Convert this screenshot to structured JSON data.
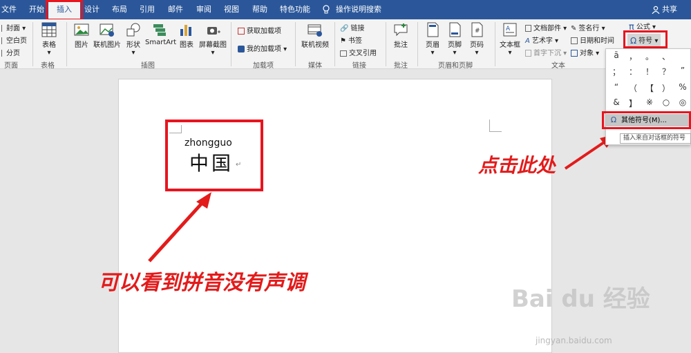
{
  "menubar": {
    "tabs": [
      {
        "label": "文件"
      },
      {
        "label": "开始"
      },
      {
        "label": "插入"
      },
      {
        "label": "设计"
      },
      {
        "label": "布局"
      },
      {
        "label": "引用"
      },
      {
        "label": "邮件"
      },
      {
        "label": "审阅"
      },
      {
        "label": "视图"
      },
      {
        "label": "帮助"
      },
      {
        "label": "特色功能"
      }
    ],
    "search_label": "操作说明搜索",
    "share_label": "共享"
  },
  "ribbon": {
    "pages": {
      "items": [
        "封面",
        "空白页",
        "分页"
      ],
      "group_label": "页面"
    },
    "tables": {
      "table_label": "表格",
      "group_label": "表格"
    },
    "illustrations": {
      "items": [
        "图片",
        "联机图片",
        "形状",
        "SmartArt",
        "图表",
        "屏幕截图"
      ],
      "group_label": "插图"
    },
    "addins": {
      "get_label": "获取加载项",
      "mine_label": "我的加载项",
      "group_label": "加载项"
    },
    "media": {
      "online_video_label": "联机视频",
      "group_label": "媒体"
    },
    "links": {
      "items": [
        "链接",
        "书签",
        "交叉引用"
      ],
      "group_label": "链接"
    },
    "comments": {
      "comment_label": "批注",
      "group_label": "批注"
    },
    "header_footer": {
      "items": [
        "页眉",
        "页脚",
        "页码"
      ],
      "group_label": "页眉和页脚"
    },
    "text": {
      "textbox_label": "文本框",
      "quick_parts_label": "文档部件",
      "wordart_label": "艺术字",
      "dropcap_label": "首字下沉",
      "signature_label": "签名行",
      "datetime_label": "日期和时间",
      "object_label": "对象",
      "group_label": "文本"
    },
    "symbols": {
      "equation_label": "公式",
      "symbol_label": "符号"
    }
  },
  "symbol_dropdown": {
    "row1": [
      "ā",
      "，",
      "。",
      "、"
    ],
    "row2": [
      "；",
      "：",
      "！",
      "？",
      "”"
    ],
    "row3": [
      "“",
      "（",
      "【",
      "）",
      "%"
    ],
    "row4": [
      "&",
      "】",
      "※",
      "○",
      "◎"
    ],
    "more_label": "其他符号(M)...",
    "tooltip": "插入来自对话框的符号"
  },
  "document": {
    "pinyin": "zhongguo",
    "hanzi": "中国",
    "para_mark": "↵"
  },
  "annotations": {
    "left_note": "可以看到拼音没有声调",
    "right_note": "点击此处"
  },
  "watermark": {
    "brand": "Bai du 经验",
    "url": "jingyan.baidu.com"
  },
  "colors": {
    "title_bar": "#2b579a",
    "ribbon": "#f3f3f3",
    "annotation_red": "#e31b1b"
  }
}
